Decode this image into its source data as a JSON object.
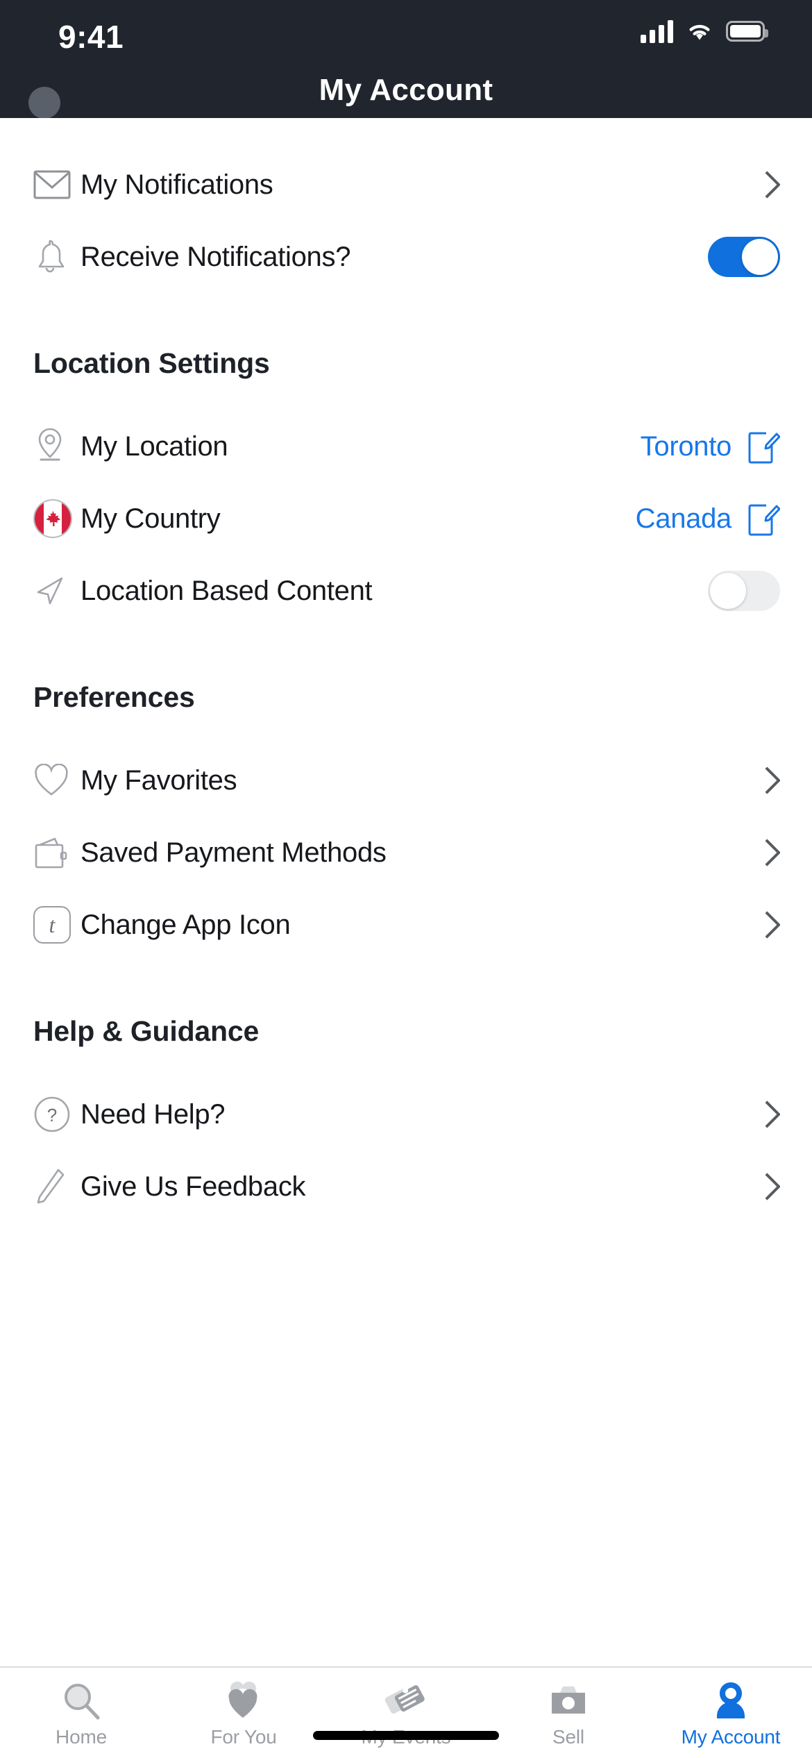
{
  "status_bar": {
    "time": "9:41",
    "signal_icon": "cellular-signal-icon",
    "wifi_icon": "wifi-icon",
    "battery_icon": "battery-icon"
  },
  "nav": {
    "title": "My Account",
    "avatar_name": "avatar"
  },
  "colors": {
    "header_bg": "#21262e",
    "accent_blue": "#1070dd",
    "link_blue": "#1877e8",
    "toggle_on": "#1070dd",
    "toggle_off": "#eceef0",
    "flag_red": "#d5203f",
    "icon_gray": "#9a9da2",
    "inactive_tab": "#9b9ea3"
  },
  "sections": [
    {
      "title": "",
      "rows": [
        {
          "label": "My Notifications",
          "icon": "envelope-icon",
          "accessory": "chevron"
        },
        {
          "label": "Receive Notifications?",
          "icon": "bell-icon",
          "accessory": "toggle",
          "toggle_state": "on"
        }
      ]
    },
    {
      "title": "Location Settings",
      "rows": [
        {
          "label": "My Location",
          "icon": "map-pin-icon",
          "accessory": "value-edit",
          "value": "Toronto",
          "edit_icon": "edit-pencil-icon"
        },
        {
          "label": "My Country",
          "icon": "canada-flag-icon",
          "accessory": "value-edit",
          "value": "Canada",
          "edit_icon": "edit-pencil-icon"
        },
        {
          "label": "Location Based Content",
          "icon": "navigation-arrow-icon",
          "accessory": "toggle",
          "toggle_state": "off"
        }
      ]
    },
    {
      "title": "Preferences",
      "rows": [
        {
          "label": "My Favorites",
          "icon": "heart-icon",
          "accessory": "chevron"
        },
        {
          "label": "Saved Payment Methods",
          "icon": "wallet-icon",
          "accessory": "chevron"
        },
        {
          "label": "Change App Icon",
          "icon": "app-icon-tile",
          "accessory": "chevron",
          "tile_glyph": "t"
        }
      ]
    },
    {
      "title": "Help & Guidance",
      "rows": [
        {
          "label": "Need Help?",
          "icon": "question-circle-icon",
          "accessory": "chevron"
        },
        {
          "label": "Give Us Feedback",
          "icon": "pencil-icon",
          "accessory": "chevron"
        }
      ]
    }
  ],
  "tabbar": {
    "tabs": [
      {
        "label": "Home",
        "icon": "search-icon",
        "active": false
      },
      {
        "label": "For You",
        "icon": "hearts-icon",
        "active": false
      },
      {
        "label": "My Events",
        "icon": "tickets-icon",
        "active": false
      },
      {
        "label": "Sell",
        "icon": "camera-icon",
        "active": false
      },
      {
        "label": "My Account",
        "icon": "person-icon",
        "active": true
      }
    ]
  }
}
